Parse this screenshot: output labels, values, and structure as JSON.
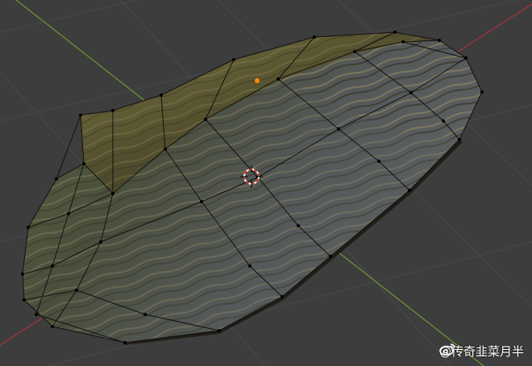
{
  "viewport": {
    "background": "#3d3d3d",
    "grid_color": "#4a4a4a",
    "x_axis_color": "#a8323c",
    "y_axis_color": "#6b9a2d",
    "wire_color": "#101010",
    "vertex_color": "#000000",
    "active_vertex_color": "#ff8a00",
    "cursor_colors": [
      "#e0302a",
      "#ffffff"
    ]
  },
  "mesh": {
    "name_icon": "shell-mesh-icon",
    "texture_tones": [
      "#6e6a3c",
      "#3f3a22",
      "#55604f",
      "#2d3328",
      "#8b7a4a"
    ]
  },
  "icons": {
    "cursor": "3d-cursor-icon",
    "weibo": "weibo-logo-icon"
  },
  "watermark": {
    "text": "@传奇韭菜月半"
  }
}
